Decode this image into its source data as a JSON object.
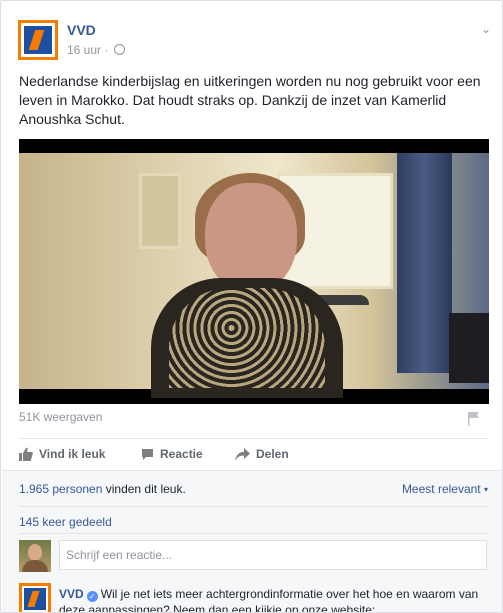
{
  "post": {
    "page_name": "VVD",
    "time": "16 uur",
    "time_separator": "·",
    "text": "Nederlandse kinderbijslag en uitkeringen worden nu nog gebruikt voor een leven in Marokko. Dat houdt straks op. Dankzij de inzet van Kamerlid Anoushka Schut.",
    "views": "51K weergaven"
  },
  "actions": {
    "like": "Vind ik leuk",
    "comment": "Reactie",
    "share": "Delen"
  },
  "engagement": {
    "likes_count": "1.965 personen",
    "likes_suffix": " vinden dit leuk.",
    "sort_label": "Meest relevant",
    "shares": "145 keer gedeeld"
  },
  "comment_box": {
    "placeholder": "Schrijf een reactie..."
  },
  "first_comment": {
    "author": "VVD",
    "text": "Wil je net iets meer achtergrondinformatie over het hoe en waarom van deze aanpassingen? Neem dan een kijkje op onze website:"
  },
  "colors": {
    "brand_blue": "#365899",
    "vvd_orange": "#f57c00",
    "vvd_blue": "#1d4fa0"
  }
}
